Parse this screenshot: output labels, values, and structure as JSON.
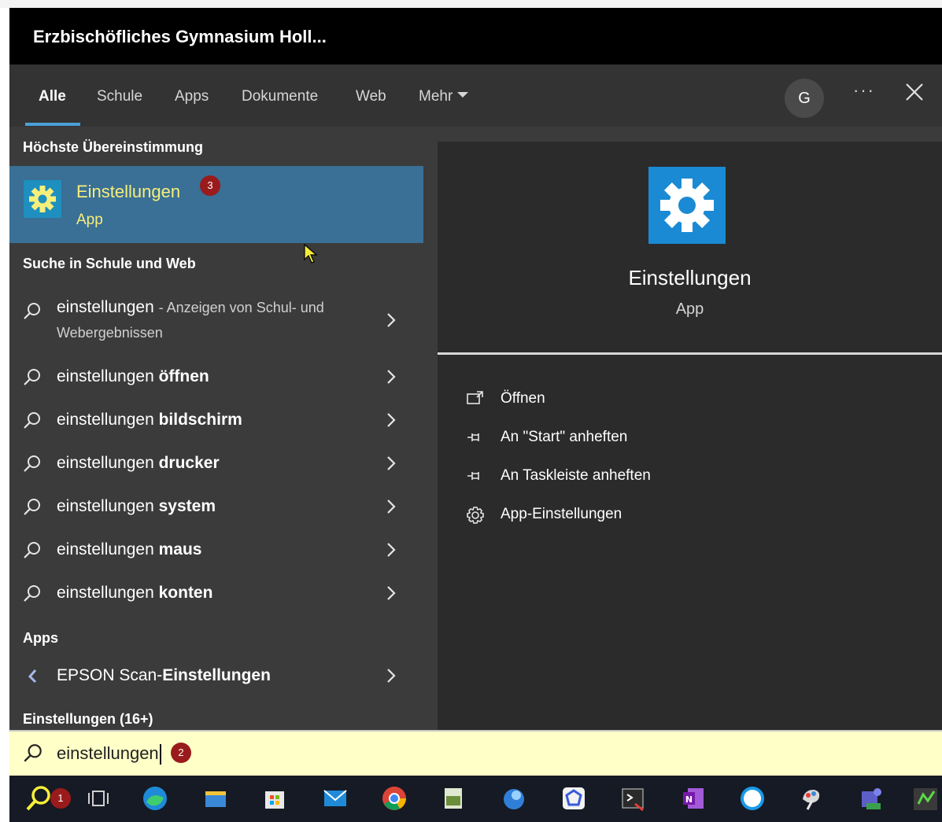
{
  "window": {
    "title": "Erzbischöfliches Gymnasium Holl..."
  },
  "tabs": [
    {
      "label": "Alle",
      "active": true
    },
    {
      "label": "Schule"
    },
    {
      "label": "Apps"
    },
    {
      "label": "Dokumente"
    },
    {
      "label": "Web"
    },
    {
      "label": "Mehr"
    }
  ],
  "account": {
    "initial": "G"
  },
  "more_options_label": "···",
  "best_match": {
    "section": "Höchste Übereinstimmung",
    "title": "Einstellungen",
    "subtitle": "App",
    "badge": "3"
  },
  "web_search": {
    "section": "Suche in Schule und Web",
    "first": {
      "query": "einstellungen",
      "hint": "- Anzeigen von Schul- und",
      "hint_line2": "Webergebnissen"
    },
    "suggestions": [
      {
        "prefix": "einstellungen ",
        "bold": "öffnen"
      },
      {
        "prefix": "einstellungen ",
        "bold": "bildschirm"
      },
      {
        "prefix": "einstellungen ",
        "bold": "drucker"
      },
      {
        "prefix": "einstellungen ",
        "bold": "system"
      },
      {
        "prefix": "einstellungen ",
        "bold": "maus"
      },
      {
        "prefix": "einstellungen ",
        "bold": "konten"
      }
    ]
  },
  "apps": {
    "section": "Apps",
    "items": [
      {
        "prefix": "EPSON Scan-",
        "bold": "Einstellungen"
      }
    ]
  },
  "settings_section": "Einstellungen (16+)",
  "detail": {
    "title": "Einstellungen",
    "subtitle": "App",
    "actions": [
      {
        "label": "Öffnen",
        "icon": "open-icon"
      },
      {
        "label": "An \"Start\" anheften",
        "icon": "pin-icon"
      },
      {
        "label": "An Taskleiste anheften",
        "icon": "pin-icon"
      },
      {
        "label": "App-Einstellungen",
        "icon": "gear-icon"
      }
    ]
  },
  "search": {
    "value": "einstellungen",
    "badge": "2"
  },
  "taskbar": {
    "search_badge": "1",
    "apps": [
      "search-icon",
      "task-view-icon",
      "edge-icon",
      "file-explorer-icon",
      "store-icon",
      "mail-icon",
      "chrome-icon",
      "notepad-icon",
      "thunderbird-icon",
      "app-icon",
      "snipping-icon",
      "onenote-icon",
      "safari-icon",
      "paint-icon",
      "teams-icon",
      "other-app-icon"
    ]
  },
  "colors": {
    "accent": "#4aa0d9",
    "selection": "#3a6f96",
    "highlight_text": "#f6ef7a",
    "badge": "#9a1b1b",
    "search_bg": "#ffffc8"
  }
}
